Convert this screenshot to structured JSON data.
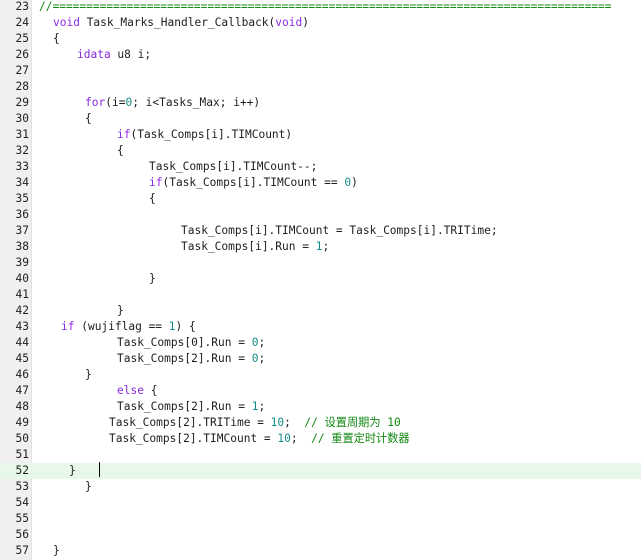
{
  "lines": [
    {
      "num": "23",
      "indent": 0,
      "tokens": [
        {
          "t": "cm",
          "v": "//==================================================================================="
        }
      ]
    },
    {
      "num": "24",
      "indent": 0,
      "tokens": [
        {
          "t": "kw",
          "v": "void"
        },
        {
          "t": "p",
          "v": " Task_Marks_Handler_Callback("
        },
        {
          "t": "kw",
          "v": "void"
        },
        {
          "t": "p",
          "v": ")"
        }
      ]
    },
    {
      "num": "25",
      "indent": 0,
      "tokens": [
        {
          "t": "p",
          "v": "{"
        }
      ]
    },
    {
      "num": "26",
      "indent": 3,
      "tokens": [
        {
          "t": "kw",
          "v": "idata"
        },
        {
          "t": "p",
          "v": " u8 i;"
        }
      ]
    },
    {
      "num": "27",
      "indent": 0,
      "tokens": []
    },
    {
      "num": "28",
      "indent": 0,
      "tokens": []
    },
    {
      "num": "29",
      "indent": 4,
      "tokens": [
        {
          "t": "kw",
          "v": "for"
        },
        {
          "t": "p",
          "v": "(i="
        },
        {
          "t": "num",
          "v": "0"
        },
        {
          "t": "p",
          "v": "; i<Tasks_Max; i++)"
        }
      ]
    },
    {
      "num": "30",
      "indent": 4,
      "tokens": [
        {
          "t": "p",
          "v": "{"
        }
      ]
    },
    {
      "num": "31",
      "indent": 8,
      "tokens": [
        {
          "t": "kw",
          "v": "if"
        },
        {
          "t": "p",
          "v": "(Task_Comps[i].TIMCount)"
        }
      ]
    },
    {
      "num": "32",
      "indent": 8,
      "tokens": [
        {
          "t": "p",
          "v": "{"
        }
      ]
    },
    {
      "num": "33",
      "indent": 12,
      "tokens": [
        {
          "t": "p",
          "v": "Task_Comps[i].TIMCount--;"
        }
      ]
    },
    {
      "num": "34",
      "indent": 12,
      "tokens": [
        {
          "t": "kw",
          "v": "if"
        },
        {
          "t": "p",
          "v": "(Task_Comps[i].TIMCount == "
        },
        {
          "t": "num",
          "v": "0"
        },
        {
          "t": "p",
          "v": ")"
        }
      ]
    },
    {
      "num": "35",
      "indent": 12,
      "tokens": [
        {
          "t": "p",
          "v": "{"
        }
      ]
    },
    {
      "num": "36",
      "indent": 0,
      "tokens": []
    },
    {
      "num": "37",
      "indent": 16,
      "tokens": [
        {
          "t": "p",
          "v": "Task_Comps[i].TIMCount = Task_Comps[i].TRITime;"
        }
      ]
    },
    {
      "num": "38",
      "indent": 16,
      "tokens": [
        {
          "t": "p",
          "v": "Task_Comps[i].Run = "
        },
        {
          "t": "num",
          "v": "1"
        },
        {
          "t": "p",
          "v": ";"
        }
      ]
    },
    {
      "num": "39",
      "indent": 0,
      "tokens": []
    },
    {
      "num": "40",
      "indent": 12,
      "tokens": [
        {
          "t": "p",
          "v": "}"
        }
      ]
    },
    {
      "num": "41",
      "indent": 0,
      "tokens": []
    },
    {
      "num": "42",
      "indent": 8,
      "tokens": [
        {
          "t": "p",
          "v": "}"
        }
      ]
    },
    {
      "num": "43",
      "indent": 1,
      "tokens": [
        {
          "t": "kw",
          "v": "if"
        },
        {
          "t": "p",
          "v": " (wujiflag == "
        },
        {
          "t": "num",
          "v": "1"
        },
        {
          "t": "p",
          "v": ") {"
        }
      ]
    },
    {
      "num": "44",
      "indent": 8,
      "tokens": [
        {
          "t": "p",
          "v": "Task_Comps[0].Run = "
        },
        {
          "t": "num",
          "v": "0"
        },
        {
          "t": "p",
          "v": ";"
        }
      ]
    },
    {
      "num": "45",
      "indent": 8,
      "tokens": [
        {
          "t": "p",
          "v": "Task_Comps[2].Run = "
        },
        {
          "t": "num",
          "v": "0"
        },
        {
          "t": "p",
          "v": ";"
        }
      ]
    },
    {
      "num": "46",
      "indent": 4,
      "tokens": [
        {
          "t": "p",
          "v": "}"
        }
      ]
    },
    {
      "num": "47",
      "indent": 8,
      "tokens": [
        {
          "t": "kw",
          "v": "else"
        },
        {
          "t": "p",
          "v": " {"
        }
      ]
    },
    {
      "num": "48",
      "indent": 8,
      "tokens": [
        {
          "t": "p",
          "v": "Task_Comps[2].Run = "
        },
        {
          "t": "num",
          "v": "1"
        },
        {
          "t": "p",
          "v": ";"
        }
      ]
    },
    {
      "num": "49",
      "indent": 7,
      "tokens": [
        {
          "t": "p",
          "v": "Task_Comps[2].TRITime = "
        },
        {
          "t": "num",
          "v": "10"
        },
        {
          "t": "p",
          "v": ";  "
        },
        {
          "t": "cm",
          "v": "// 设置周期为 10"
        }
      ]
    },
    {
      "num": "50",
      "indent": 7,
      "tokens": [
        {
          "t": "p",
          "v": "Task_Comps[2].TIMCount = "
        },
        {
          "t": "num",
          "v": "10"
        },
        {
          "t": "p",
          "v": ";  "
        },
        {
          "t": "cm",
          "v": "// 重置定时计数器"
        }
      ]
    },
    {
      "num": "51",
      "indent": 0,
      "tokens": []
    },
    {
      "num": "52",
      "indent": 2,
      "current": true,
      "tokens": [
        {
          "t": "p",
          "v": "}"
        }
      ]
    },
    {
      "num": "53",
      "indent": 4,
      "tokens": [
        {
          "t": "p",
          "v": "}"
        }
      ]
    },
    {
      "num": "54",
      "indent": 0,
      "tokens": []
    },
    {
      "num": "55",
      "indent": 0,
      "tokens": []
    },
    {
      "num": "56",
      "indent": 0,
      "tokens": []
    },
    {
      "num": "57",
      "indent": 0,
      "tokens": [
        {
          "t": "p",
          "v": "}"
        }
      ]
    }
  ],
  "colors": {
    "keyword": "#8a2be2",
    "number": "#168a8a",
    "comment": "#118811",
    "text": "#1e1e1e",
    "gutter": "#f0f0f0",
    "current_line": "#e8f8e8"
  }
}
